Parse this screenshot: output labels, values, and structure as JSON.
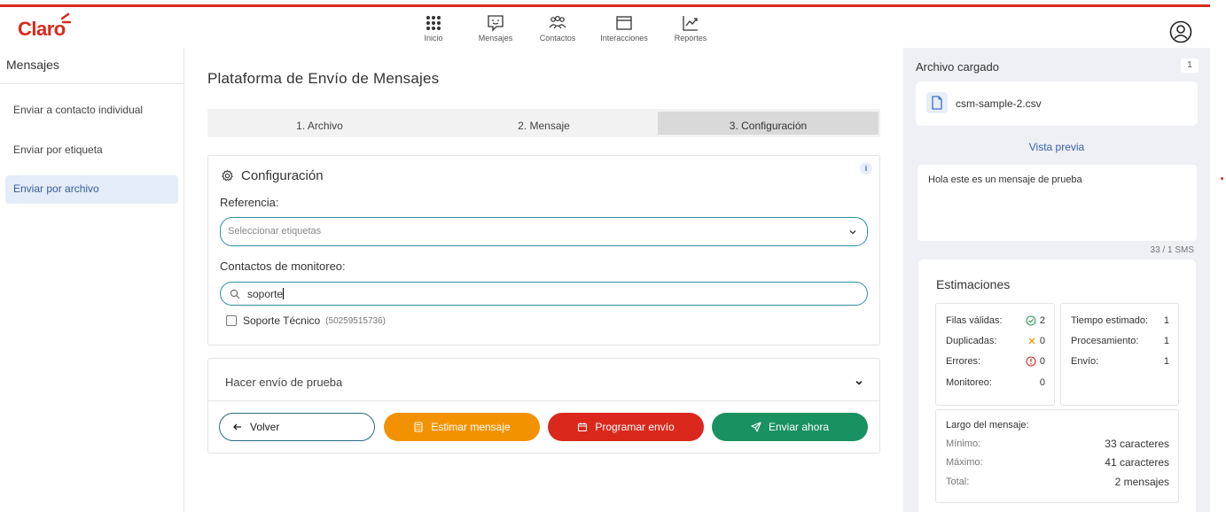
{
  "brand": {
    "logo_text": "Claro",
    "accent": "#da291c"
  },
  "topnav": {
    "items": [
      {
        "label": "Inicio",
        "icon": "grid-icon"
      },
      {
        "label": "Mensajes",
        "icon": "message-icon"
      },
      {
        "label": "Contactos",
        "icon": "contacts-icon"
      },
      {
        "label": "Interacciones",
        "icon": "window-icon"
      },
      {
        "label": "Reportes",
        "icon": "chart-icon"
      }
    ]
  },
  "sidebar": {
    "title": "Mensajes",
    "items": [
      {
        "label": "Enviar a contacto individual",
        "active": false
      },
      {
        "label": "Enviar por etiqueta",
        "active": false
      },
      {
        "label": "Enviar por archivo",
        "active": true
      }
    ]
  },
  "main": {
    "title": "Plataforma de Envío de Mensajes",
    "steps": [
      "1. Archivo",
      "2. Mensaje",
      "3. Configuración"
    ],
    "active_step": 3,
    "config": {
      "title": "Configuración",
      "info": "i",
      "reference_label": "Referencia:",
      "reference_placeholder": "Seleccionar etiquetas",
      "monitor_label": "Contactos de monitoreo:",
      "search_value": "soporte",
      "result_name": "Soporte Técnico",
      "result_phone": "(50259515736)",
      "result_checked": false
    },
    "test_send": {
      "title": "Hacer envío de prueba"
    },
    "buttons": {
      "back": "Volver",
      "estimate": "Estimar mensaje",
      "schedule": "Programar envío",
      "send": "Enviar ahora"
    }
  },
  "right_panel": {
    "title": "Archivo cargado",
    "count": "1",
    "file_name": "csm-sample-2.csv",
    "preview_label": "Vista previa",
    "message": "Hola este es un mensaje de prueba",
    "sms_counter": "33 / 1 SMS",
    "estimates": {
      "title": "Estimaciones",
      "valid_label": "Filas válidas:",
      "valid_value": "2",
      "duplicate_label": "Duplicadas:",
      "duplicate_value": "0",
      "errors_label": "Errores:",
      "errors_value": "0",
      "monitor_label": "Monitoreo:",
      "monitor_value": "0",
      "time_label": "Tiempo estimado:",
      "time_value": "1",
      "processing_label": "Procesamiento:",
      "processing_value": "1",
      "send_label": "Envío:",
      "send_value": "1",
      "length_title": "Largo del mensaje:",
      "min_label": "Mínimo:",
      "min_value": "33 caracteres",
      "max_label": "Máximo:",
      "max_value": "41 caracteres",
      "total_label": "Total:",
      "total_value": "2 mensajes"
    }
  }
}
